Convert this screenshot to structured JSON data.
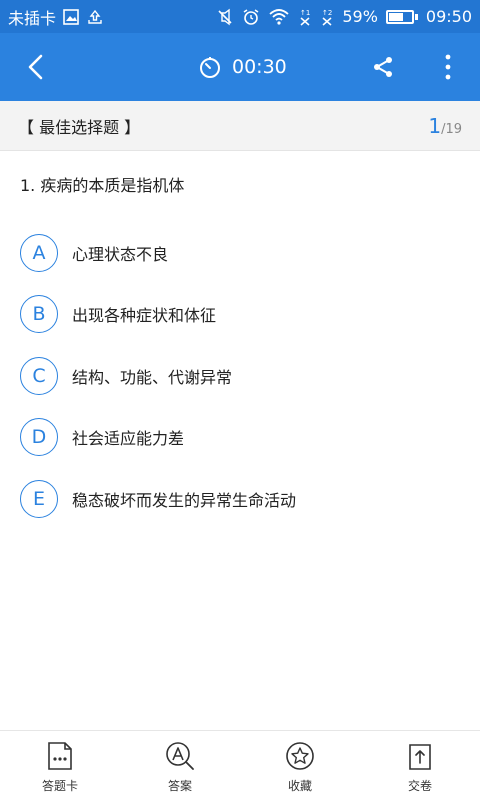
{
  "status_bar": {
    "carrier": "未插卡",
    "battery_percent": "59%",
    "battery_level": 0.59,
    "time": "09:50"
  },
  "app_bar": {
    "timer": "00:30",
    "icons": [
      "back-arrow-icon",
      "stopwatch-icon",
      "share-icon",
      "more-vert-icon"
    ]
  },
  "question_header": {
    "type": "【 最佳选择题 】",
    "current": "1",
    "separator": "/",
    "total": "19"
  },
  "question": {
    "text": "1. 疾病的本质是指机体"
  },
  "options": [
    {
      "letter": "A",
      "text": "心理状态不良"
    },
    {
      "letter": "B",
      "text": "出现各种症状和体征"
    },
    {
      "letter": "C",
      "text": "结构、功能、代谢异常"
    },
    {
      "letter": "D",
      "text": "社会适应能力差"
    },
    {
      "letter": "E",
      "text": "稳态破坏而发生的异常生命活动"
    }
  ],
  "bottom_bar": {
    "answer_sheet": "答题卡",
    "answer": "答案",
    "favorite": "收藏",
    "submit": "交卷"
  },
  "colors": {
    "status_bar": "#2376d2",
    "app_bar": "#2b82df",
    "accent": "#2b82df"
  }
}
